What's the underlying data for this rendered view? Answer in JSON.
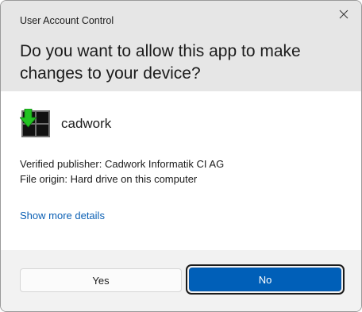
{
  "dialog": {
    "window_title": "User Account Control",
    "question": "Do you want to allow this app to make changes to your device?",
    "close_icon": "close-icon"
  },
  "app": {
    "name": "cadwork",
    "icon": "cadwork-app-icon",
    "verified_publisher": "Verified publisher: Cadwork Informatik CI AG",
    "file_origin": "File origin: Hard drive on this computer"
  },
  "link": {
    "show_more": "Show more details"
  },
  "buttons": {
    "yes": "Yes",
    "no": "No"
  },
  "colors": {
    "header_bg": "#e6e6e6",
    "footer_bg": "#f2f2f2",
    "accent": "#005fb8",
    "link": "#0a5fb4",
    "icon_arrow": "#22c322"
  }
}
